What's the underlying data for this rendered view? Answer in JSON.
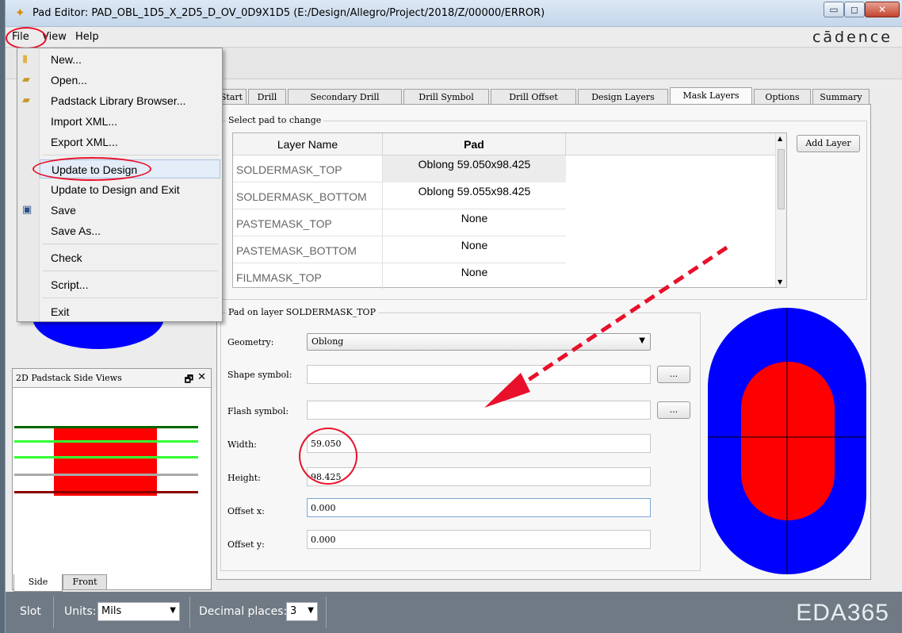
{
  "window": {
    "title": "Pad Editor: PAD_OBL_1D5_X_2D5_D_OV_0D9X1D5  (E:/Design/Allegro/Project/2018/Z/00000/ERROR)",
    "app_icon": "pad-editor-icon",
    "controls": {
      "minimize": "▭",
      "maximize": "◻",
      "close": "✕"
    }
  },
  "menubar": {
    "file": "File",
    "view": "View",
    "help": "Help",
    "brand": "cādence"
  },
  "file_menu": {
    "items": [
      "New...",
      "Open...",
      "Padstack Library Browser...",
      "Import XML...",
      "Export XML...",
      "Update to Design",
      "Update to Design and Exit",
      "Save",
      "Save As...",
      "Check",
      "Script...",
      "Exit"
    ],
    "highlighted": "Update to Design"
  },
  "tabs": [
    "Start",
    "Drill",
    "Secondary Drill",
    "Drill Symbol",
    "Drill Offset",
    "Design Layers",
    "Mask Layers",
    "Options",
    "Summary"
  ],
  "active_tab": "Mask Layers",
  "select_group": {
    "label": "Select pad to change",
    "columns": [
      "Layer Name",
      "Pad"
    ],
    "rows": [
      {
        "layer": "SOLDERMASK_TOP",
        "pad": "Oblong 59.050x98.425"
      },
      {
        "layer": "SOLDERMASK_BOTTOM",
        "pad": "Oblong 59.055x98.425"
      },
      {
        "layer": "PASTEMASK_TOP",
        "pad": "None"
      },
      {
        "layer": "PASTEMASK_BOTTOM",
        "pad": "None"
      },
      {
        "layer": "FILMMASK_TOP",
        "pad": "None"
      }
    ],
    "add_layer": "Add Layer"
  },
  "pad_group": {
    "label": "Pad on layer SOLDERMASK_TOP",
    "geometry_label": "Geometry:",
    "geometry_value": "Oblong",
    "shape_symbol_label": "Shape symbol:",
    "flash_symbol_label": "Flash symbol:",
    "browse": "...",
    "width_label": "Width:",
    "width_value": "59.050",
    "height_label": "Height:",
    "height_value": "98.425",
    "offset_x_label": "Offset x:",
    "offset_x_value": "0.000",
    "offset_y_label": "Offset y:",
    "offset_y_value": "0.000"
  },
  "side_views": {
    "title": "2D Padstack Side Views",
    "tab_side": "Side",
    "tab_front": "Front"
  },
  "statusbar": {
    "slot": "Slot",
    "units_label": "Units:",
    "units_value": "Mils",
    "decimal_label": "Decimal places:",
    "decimal_value": "3",
    "logo": "EDA365"
  },
  "colors": {
    "pad_blue": "#0000ff",
    "pad_red": "#ff0000",
    "annotation_red": "#e8102a"
  }
}
